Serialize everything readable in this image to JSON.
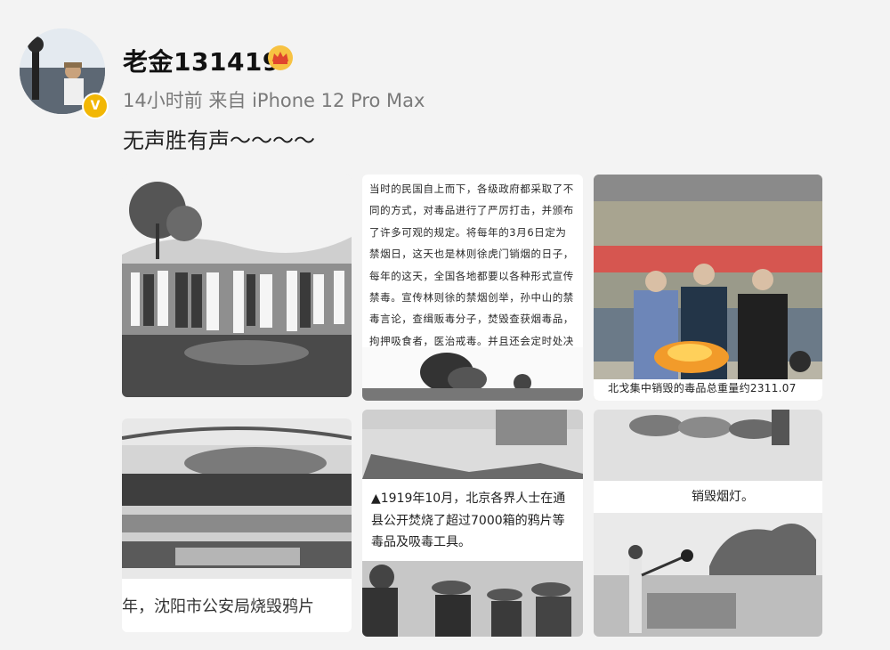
{
  "post": {
    "username": "老金131419",
    "meta": "14小时前  来自 iPhone 12 Pro Max",
    "content": "无声胜有声～～～～",
    "badge_icon": "vip-crown-icon",
    "verified_icon": "verified-v-badge-icon"
  },
  "images": {
    "img2_text": "当时的民国自上而下，各级政府都采取了不同的方式，对毒品进行了严厉打击，并颁布了许多可观的规定。将每年的3月6日定为禁烟日，这天也是林则徐虎门销烟的日子，每年的这天，全国各地都要以各种形式宣传禁毒。宣传林则徐的禁烟创举，孙中山的禁毒言论，查缉贩毒分子，焚毁查获烟毒品，拘押吸食者，医治戒毒。并且还会定时处决一批毒犯。销毁毒品的现场，其中还有大烟等毒品和烟具。",
    "img3_caption": "北戈集中销毁的毒品总重量约2311.07",
    "img6_caption": "销毁烟灯。",
    "img5_caption": "▲1919年10月，北京各界人士在通县公开焚烧了超过7000箱的鸦片等毒品及吸毒工具。",
    "img4_caption": "年，沈阳市公安局烧毁鸦片"
  }
}
